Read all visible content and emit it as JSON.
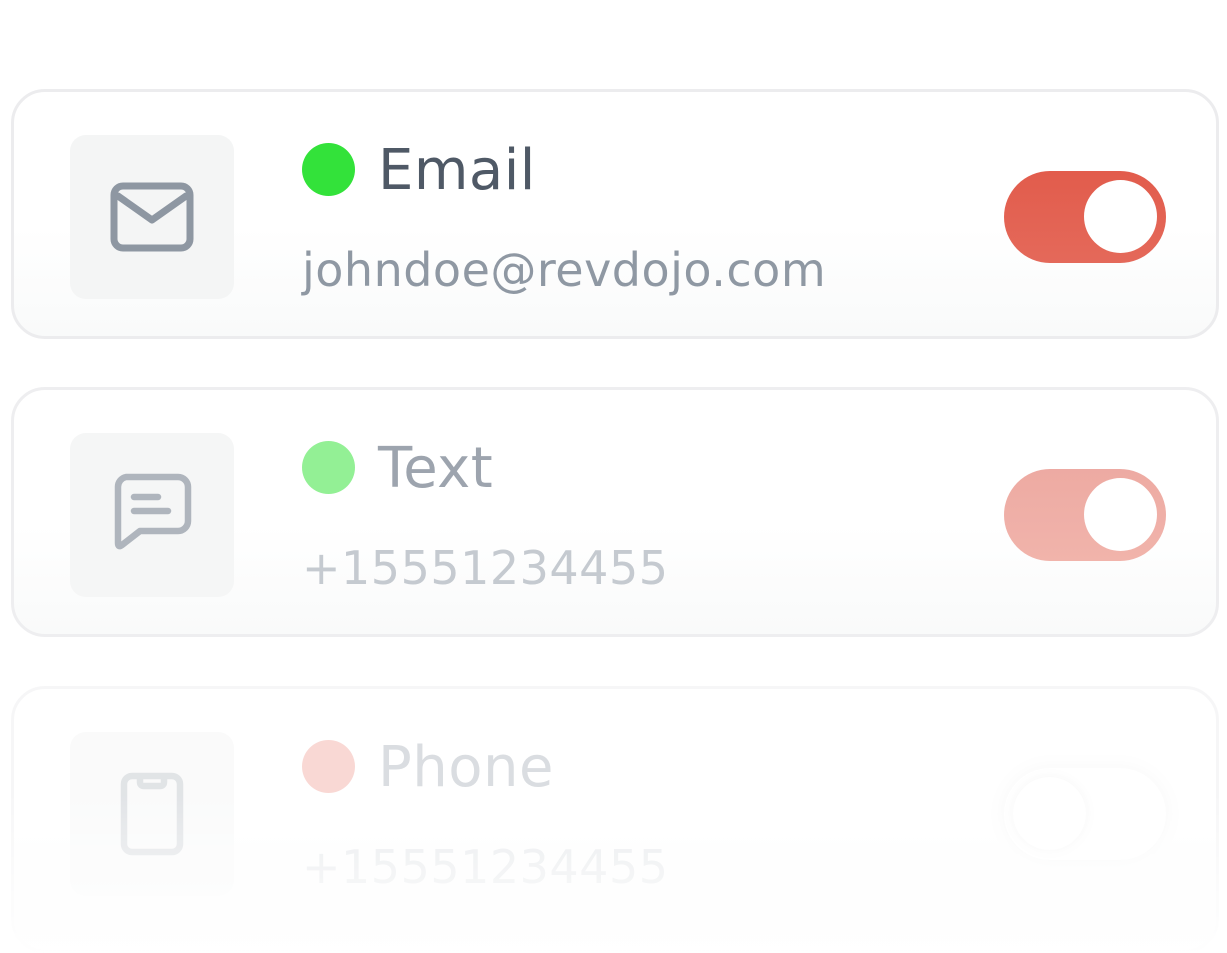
{
  "channels": [
    {
      "label": "Email",
      "value": "johndoe@revdojo.com",
      "icon": "envelope-icon",
      "status_color": "#33e23a",
      "enabled": true
    },
    {
      "label": "Text",
      "value": "+15551234455",
      "icon": "message-icon",
      "status_color": "#82ee84",
      "enabled": true
    },
    {
      "label": "Phone",
      "value": "+15551234455",
      "icon": "phone-icon",
      "status_color": "#f2a49a",
      "enabled": false
    }
  ],
  "colors": {
    "toggle_on": "#e25c4c",
    "card_border": "#ececee",
    "icon_tile": "#f4f5f5"
  }
}
